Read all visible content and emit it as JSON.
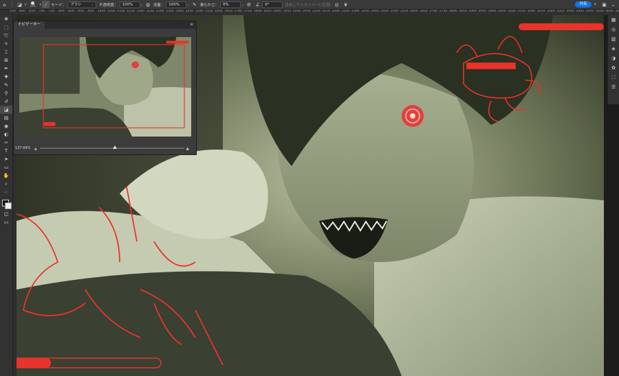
{
  "options_bar": {
    "brush_size": "175",
    "mode_label": "モード：",
    "mode_value": "ブラシ",
    "opacity_label": "不透明度：",
    "opacity_value": "100%",
    "flow_label": "流量：",
    "flow_value": "100%",
    "smoothing_label": "滑らかさ：",
    "smoothing_value": "8%",
    "angle_value": "0°",
    "history_label": "消去してヒストリーに記録",
    "share_label": "共有"
  },
  "ruler": {
    "marks": [
      "550",
      "600",
      "650",
      "700",
      "750",
      "800",
      "850",
      "900",
      "950",
      "1000",
      "1050",
      "1100",
      "1150",
      "1200",
      "1250",
      "1300",
      "1350",
      "1400",
      "1450",
      "1500",
      "1550",
      "1600",
      "1650",
      "1700",
      "1750",
      "1800",
      "1850",
      "1900",
      "1950",
      "2000",
      "2050",
      "2100",
      "2150",
      "2200",
      "2250",
      "2300",
      "2350",
      "2400",
      "2450",
      "2500",
      "2550",
      "2600",
      "2650",
      "2700",
      "2750",
      "2800",
      "2850",
      "2900",
      "2950",
      "3000",
      "3050",
      "3100",
      "3150",
      "3200",
      "3250",
      "3300",
      "3350",
      "3400",
      "3450",
      "3500",
      "3550",
      "3600",
      "3650"
    ]
  },
  "navigator": {
    "tab_label": "ナビゲーター",
    "zoom_value": "137.89%",
    "zoom_fraction": 0.52
  },
  "colors": {
    "accent_blue": "#1473e6",
    "sketch_red": "#e8342a",
    "artwork_tone": "#8f9a7a"
  },
  "toolbar_icons": [
    "move-icon",
    "marquee-icon",
    "lasso-icon",
    "object-select-icon",
    "crop-icon",
    "frame-icon",
    "eyedropper-icon",
    "healing-brush-icon",
    "brush-icon",
    "clone-stamp-icon",
    "history-brush-icon",
    "eraser-icon",
    "gradient-icon",
    "blur-icon",
    "dodge-icon",
    "pen-icon",
    "type-icon",
    "path-select-icon",
    "rectangle-icon",
    "hand-icon",
    "zoom-icon",
    "more-tools-icon"
  ],
  "right_icons": [
    "grid-icon",
    "channels-icon",
    "gradients-icon",
    "layers-icon",
    "adjustments-icon",
    "properties-icon",
    "transform-icon",
    "sliders-icon"
  ]
}
